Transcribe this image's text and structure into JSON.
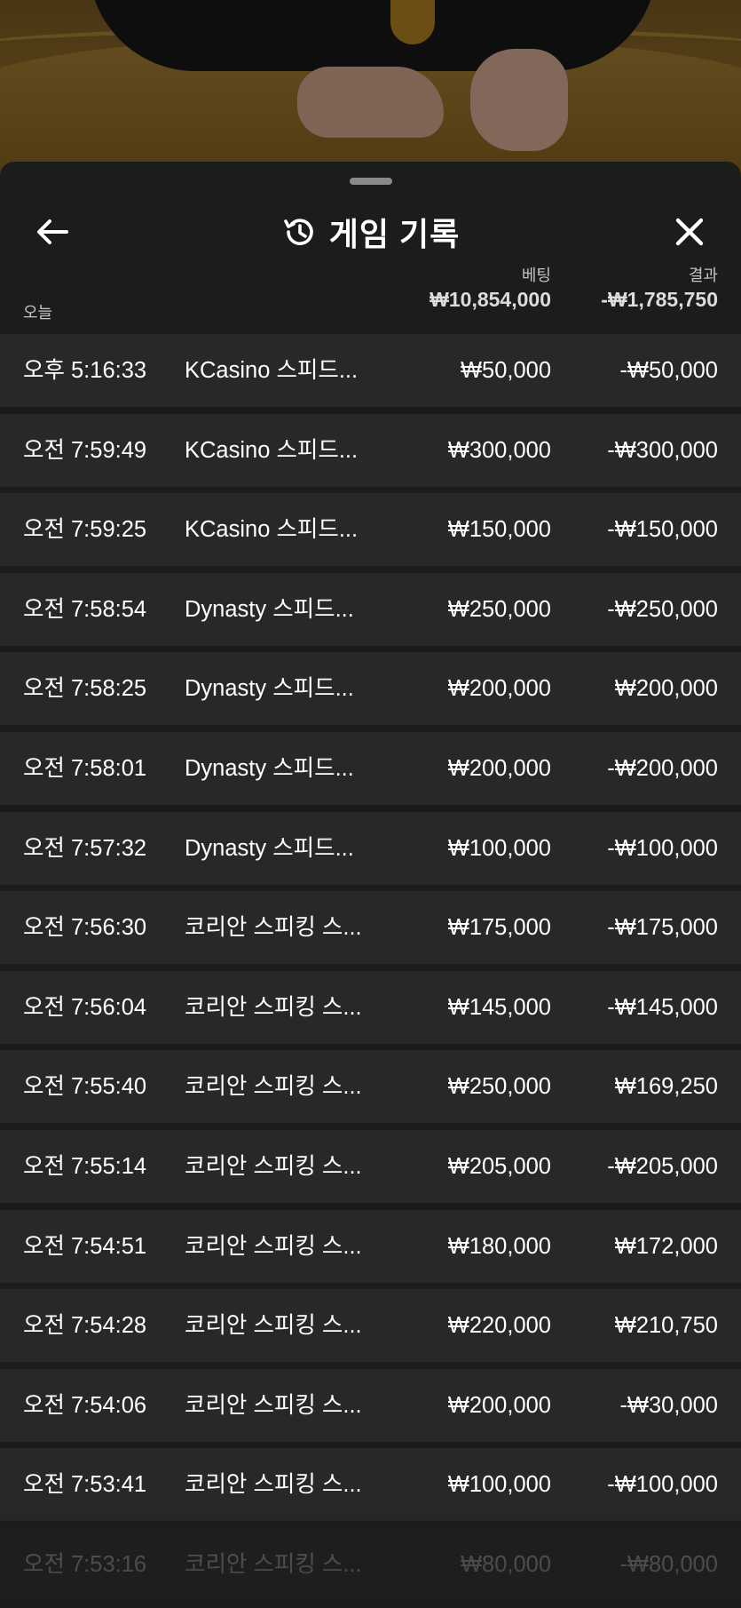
{
  "header": {
    "title": "게임 기록",
    "back_icon": "arrow-left-icon",
    "history_icon": "history-clock-icon",
    "close_icon": "close-icon"
  },
  "columns": {
    "date_group": "오늘",
    "bet_label": "베팅",
    "result_label": "결과",
    "bet_total": "₩10,854,000",
    "result_total": "-₩1,785,750"
  },
  "rows": [
    {
      "time": "오후 5:16:33",
      "game": "KCasino 스피드...",
      "bet": "₩50,000",
      "result": "-₩50,000"
    },
    {
      "time": "오전 7:59:49",
      "game": "KCasino 스피드...",
      "bet": "₩300,000",
      "result": "-₩300,000"
    },
    {
      "time": "오전 7:59:25",
      "game": "KCasino 스피드...",
      "bet": "₩150,000",
      "result": "-₩150,000"
    },
    {
      "time": "오전 7:58:54",
      "game": "Dynasty 스피드...",
      "bet": "₩250,000",
      "result": "-₩250,000"
    },
    {
      "time": "오전 7:58:25",
      "game": "Dynasty 스피드...",
      "bet": "₩200,000",
      "result": "₩200,000"
    },
    {
      "time": "오전 7:58:01",
      "game": "Dynasty 스피드...",
      "bet": "₩200,000",
      "result": "-₩200,000"
    },
    {
      "time": "오전 7:57:32",
      "game": "Dynasty 스피드...",
      "bet": "₩100,000",
      "result": "-₩100,000"
    },
    {
      "time": "오전 7:56:30",
      "game": "코리안 스피킹 스...",
      "bet": "₩175,000",
      "result": "-₩175,000"
    },
    {
      "time": "오전 7:56:04",
      "game": "코리안 스피킹 스...",
      "bet": "₩145,000",
      "result": "-₩145,000"
    },
    {
      "time": "오전 7:55:40",
      "game": "코리안 스피킹 스...",
      "bet": "₩250,000",
      "result": "₩169,250"
    },
    {
      "time": "오전 7:55:14",
      "game": "코리안 스피킹 스...",
      "bet": "₩205,000",
      "result": "-₩205,000"
    },
    {
      "time": "오전 7:54:51",
      "game": "코리안 스피킹 스...",
      "bet": "₩180,000",
      "result": "₩172,000"
    },
    {
      "time": "오전 7:54:28",
      "game": "코리안 스피킹 스...",
      "bet": "₩220,000",
      "result": "₩210,750"
    },
    {
      "time": "오전 7:54:06",
      "game": "코리안 스피킹 스...",
      "bet": "₩200,000",
      "result": "-₩30,000"
    },
    {
      "time": "오전 7:53:41",
      "game": "코리안 스피킹 스...",
      "bet": "₩100,000",
      "result": "-₩100,000"
    },
    {
      "time": "오전 7:53:16",
      "game": "코리안 스피킹 스...",
      "bet": "₩80,000",
      "result": "-₩80,000"
    }
  ]
}
